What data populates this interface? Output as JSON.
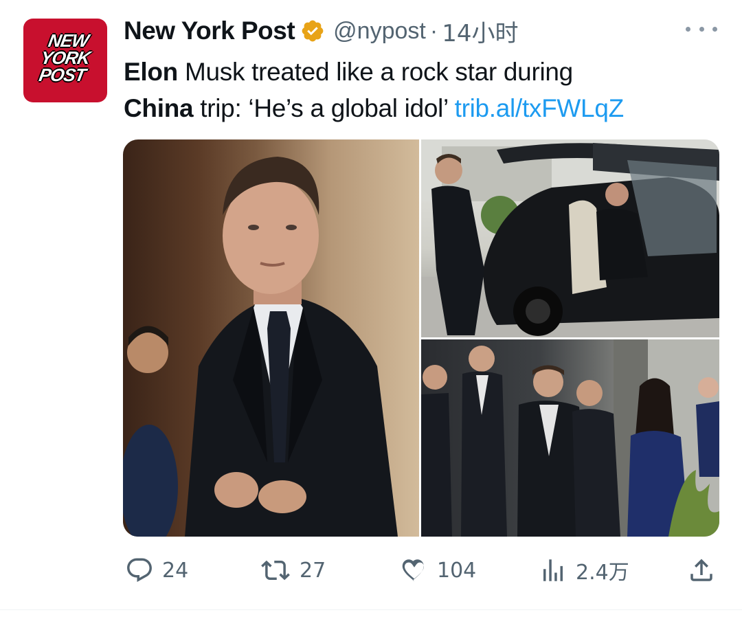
{
  "account": {
    "avatar_lines": [
      "NEW",
      "YORK",
      "POST"
    ],
    "display_name": "New York Post",
    "handle": "@nypost",
    "separator": "·",
    "time": "14小时",
    "verified_icon": "gold-verified-badge-icon",
    "brand_color": "#c8102e",
    "verified_color": "#e8a317"
  },
  "tweet": {
    "text_bold_1": "Elon",
    "text_1": " Musk treated like a rock star during",
    "text_bold_2": "China",
    "text_2": " trip: ‘He’s a global idol’ ",
    "link": "trib.al/txFWLqZ",
    "link_color": "#1d9bf0"
  },
  "media": {
    "photos": [
      {
        "description": "Elon Musk in dark suit buttoning jacket"
      },
      {
        "description": "Musk seated in Tesla with falcon-wing door open, bodyguard standing"
      },
      {
        "description": "Musk walking with group of people outside building"
      }
    ]
  },
  "actions": {
    "reply": {
      "icon": "reply-bubble-icon",
      "count": "24"
    },
    "retweet": {
      "icon": "retweet-icon",
      "count": "27"
    },
    "like": {
      "icon": "heart-icon",
      "count": "104"
    },
    "views": {
      "icon": "views-bar-chart-icon",
      "count": "2.4万"
    },
    "share": {
      "icon": "share-upload-icon"
    }
  },
  "menu": {
    "icon": "more-options-icon"
  }
}
